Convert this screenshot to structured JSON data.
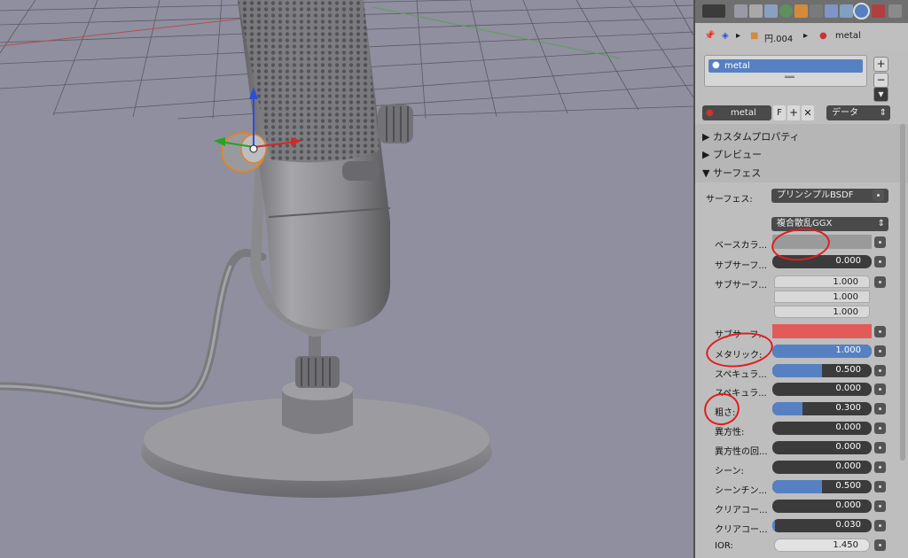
{
  "breadcrumb": {
    "object": "円.004",
    "material": "metal"
  },
  "material_list": {
    "selected": "metal",
    "add_symbol": "+",
    "remove_symbol": "−"
  },
  "material_selector": {
    "name": "metal",
    "fake_user": "F",
    "data_dropdown": "データ"
  },
  "sections": {
    "custom_props": "カスタムプロパティ",
    "preview": "プレビュー",
    "surface": "サーフェス"
  },
  "surface": {
    "surface_label": "サーフェス:",
    "surface_value": "プリンシプルBSDF",
    "distribution": "複合散乱GGX"
  },
  "props": {
    "base_color": "ベースカラ...",
    "subsurface": "サブサーフ...",
    "subsurface_value": "0.000",
    "subsurface_radius": "サブサーフ...",
    "radius_1": "1.000",
    "radius_2": "1.000",
    "radius_3": "1.000",
    "subsurface_color": "サブサーフ...",
    "metallic": "メタリック:",
    "metallic_value": "1.000",
    "specular": "スペキュラ...",
    "specular_value": "0.500",
    "specular_tint": "スペキュラ...",
    "specular_tint_value": "0.000",
    "roughness": "粗さ:",
    "roughness_value": "0.300",
    "anisotropic": "異方性:",
    "anisotropic_value": "0.000",
    "anisotropic_rot": "異方性の回...",
    "anisotropic_rot_value": "0.000",
    "sheen": "シーン:",
    "sheen_value": "0.000",
    "sheen_tint": "シーンチン...",
    "sheen_tint_value": "0.500",
    "clearcoat": "クリアコー...",
    "clearcoat_value": "0.000",
    "clearcoat_rough": "クリアコー...",
    "clearcoat_rough_value": "0.030",
    "ior": "IOR:",
    "ior_value": "1.450"
  },
  "sliders": {
    "subsurface": 0.0,
    "metallic": 1.0,
    "specular": 0.5,
    "specular_tint": 0.0,
    "roughness": 0.3,
    "anisotropic": 0.0,
    "anisotropic_rot": 0.0,
    "sheen": 0.0,
    "sheen_tint": 0.5,
    "clearcoat": 0.0,
    "clearcoat_rough": 0.03
  },
  "colors": {
    "subsurface_color": "#e25a5a",
    "accent": "#5680c2",
    "annotation": "#e01d1d"
  }
}
